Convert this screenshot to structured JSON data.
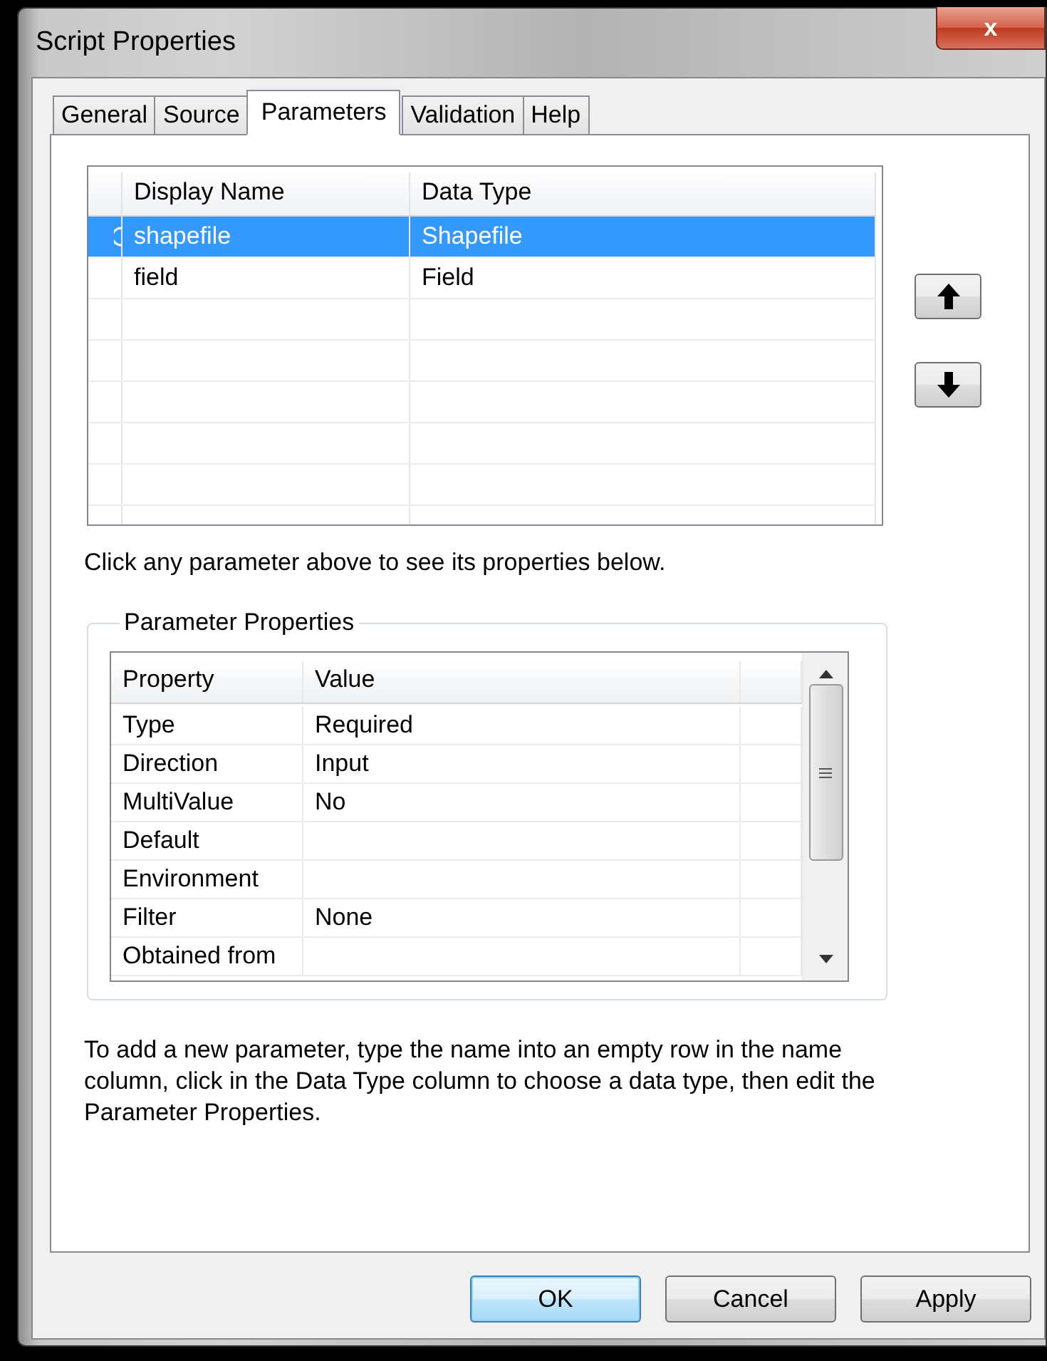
{
  "window": {
    "title": "Script Properties",
    "close": "x"
  },
  "tabs": [
    {
      "label": "General",
      "selected": false
    },
    {
      "label": "Source",
      "selected": false
    },
    {
      "label": "Parameters",
      "selected": true
    },
    {
      "label": "Validation",
      "selected": false
    },
    {
      "label": "Help",
      "selected": false
    }
  ],
  "parameters_table": {
    "columns": [
      "Display Name",
      "Data Type"
    ],
    "rows": [
      {
        "cells": [
          "shapefile",
          "Shapefile"
        ],
        "selected": true
      },
      {
        "cells": [
          "field",
          "Field"
        ],
        "selected": false
      }
    ]
  },
  "hint": "Click any parameter above to see its properties below.",
  "parameter_properties": {
    "title": "Parameter Properties",
    "columns": [
      "Property",
      "Value"
    ],
    "rows": [
      {
        "property": "Type",
        "value": "Required"
      },
      {
        "property": "Direction",
        "value": "Input"
      },
      {
        "property": "MultiValue",
        "value": "No"
      },
      {
        "property": "Default"
      },
      {
        "property": "Environment"
      },
      {
        "property": "Filter",
        "value": "None"
      },
      {
        "property": "Obtained from"
      }
    ]
  },
  "help_text": "To add a new parameter, type the name into an empty row in the name column, click in the Data Type column to choose a data type, then edit the Parameter Properties.",
  "buttons": [
    {
      "label": "OK",
      "default": true
    },
    {
      "label": "Cancel",
      "default": false
    },
    {
      "label": "Apply",
      "default": false
    }
  ]
}
